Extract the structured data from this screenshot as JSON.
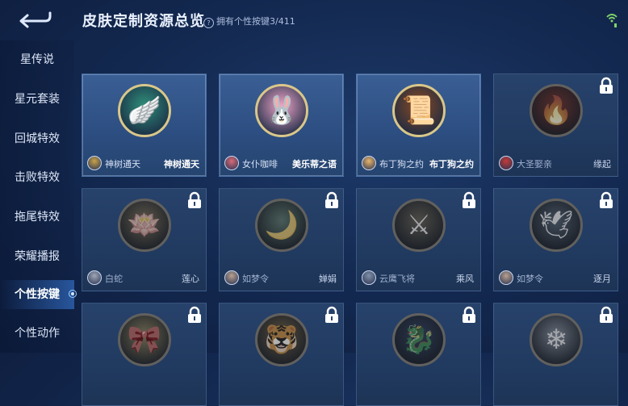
{
  "header": {
    "title": "皮肤定制资源总览",
    "owned_prefix": "拥有个性按键",
    "owned_count": "3/411",
    "help_icon": "question-icon",
    "back_icon": "back-arrow-icon",
    "status_icon": "wifi-signal-icon"
  },
  "sidebar": {
    "items": [
      {
        "label": "星传说"
      },
      {
        "label": "星元套装"
      },
      {
        "label": "回城特效"
      },
      {
        "label": "击败特效"
      },
      {
        "label": "拖尾特效"
      },
      {
        "label": "荣耀播报"
      },
      {
        "label": "个性按键"
      },
      {
        "label": "个性动作"
      }
    ],
    "active_index": 6
  },
  "cards": [
    {
      "hero": "神树通天",
      "skin": "神树通天",
      "locked": false,
      "icon": "golden-wings-icon",
      "color": "#2f8f7a",
      "avatar_color": "#c9a24a"
    },
    {
      "hero": "女仆咖啡",
      "skin": "美乐蒂之语",
      "locked": false,
      "icon": "melody-bunny-icon",
      "color": "#f0a5c8",
      "avatar_color": "#d86b7a"
    },
    {
      "hero": "布丁狗之约",
      "skin": "布丁狗之约",
      "locked": false,
      "icon": "golden-scroll-icon",
      "color": "#8a4a22",
      "avatar_color": "#e8b56a"
    },
    {
      "hero": "大圣娶亲",
      "skin": "缘起",
      "locked": true,
      "icon": "red-staff-icon",
      "color": "#b5302c",
      "avatar_color": "#c23a3a"
    },
    {
      "hero": "白蛇",
      "skin": "莲心",
      "locked": true,
      "icon": "lotus-icon",
      "color": "#8e7a54",
      "avatar_color": "#9fa8b8"
    },
    {
      "hero": "如梦令",
      "skin": "婵娟",
      "locked": true,
      "icon": "moon-fan-icon",
      "color": "#4e8a7e",
      "avatar_color": "#b8a090"
    },
    {
      "hero": "云鹰飞将",
      "skin": "乘风",
      "locked": true,
      "icon": "spear-icon",
      "color": "#6e6a5a",
      "avatar_color": "#8090a8"
    },
    {
      "hero": "如梦令",
      "skin": "逐月",
      "locked": true,
      "icon": "crane-wings-icon",
      "color": "#4a6e9a",
      "avatar_color": "#b8a090"
    },
    {
      "hero": "",
      "skin": "",
      "locked": true,
      "icon": "ribbon-icon",
      "color": "#a08e4a",
      "avatar_color": "#9fa8b8"
    },
    {
      "hero": "",
      "skin": "",
      "locked": true,
      "icon": "tiger-icon",
      "color": "#8a6a3a",
      "avatar_color": "#9fa8b8"
    },
    {
      "hero": "",
      "skin": "",
      "locked": true,
      "icon": "blue-dragon-icon",
      "color": "#2a4e9a",
      "avatar_color": "#9fa8b8"
    },
    {
      "hero": "",
      "skin": "",
      "locked": true,
      "icon": "frost-blade-icon",
      "color": "#7e98c0",
      "avatar_color": "#9fa8b8"
    }
  ],
  "colors": {
    "background": "#142a52",
    "card": "#2c4d80",
    "active_tab": "#3c82e6",
    "accent_gold": "#d9c78a"
  }
}
